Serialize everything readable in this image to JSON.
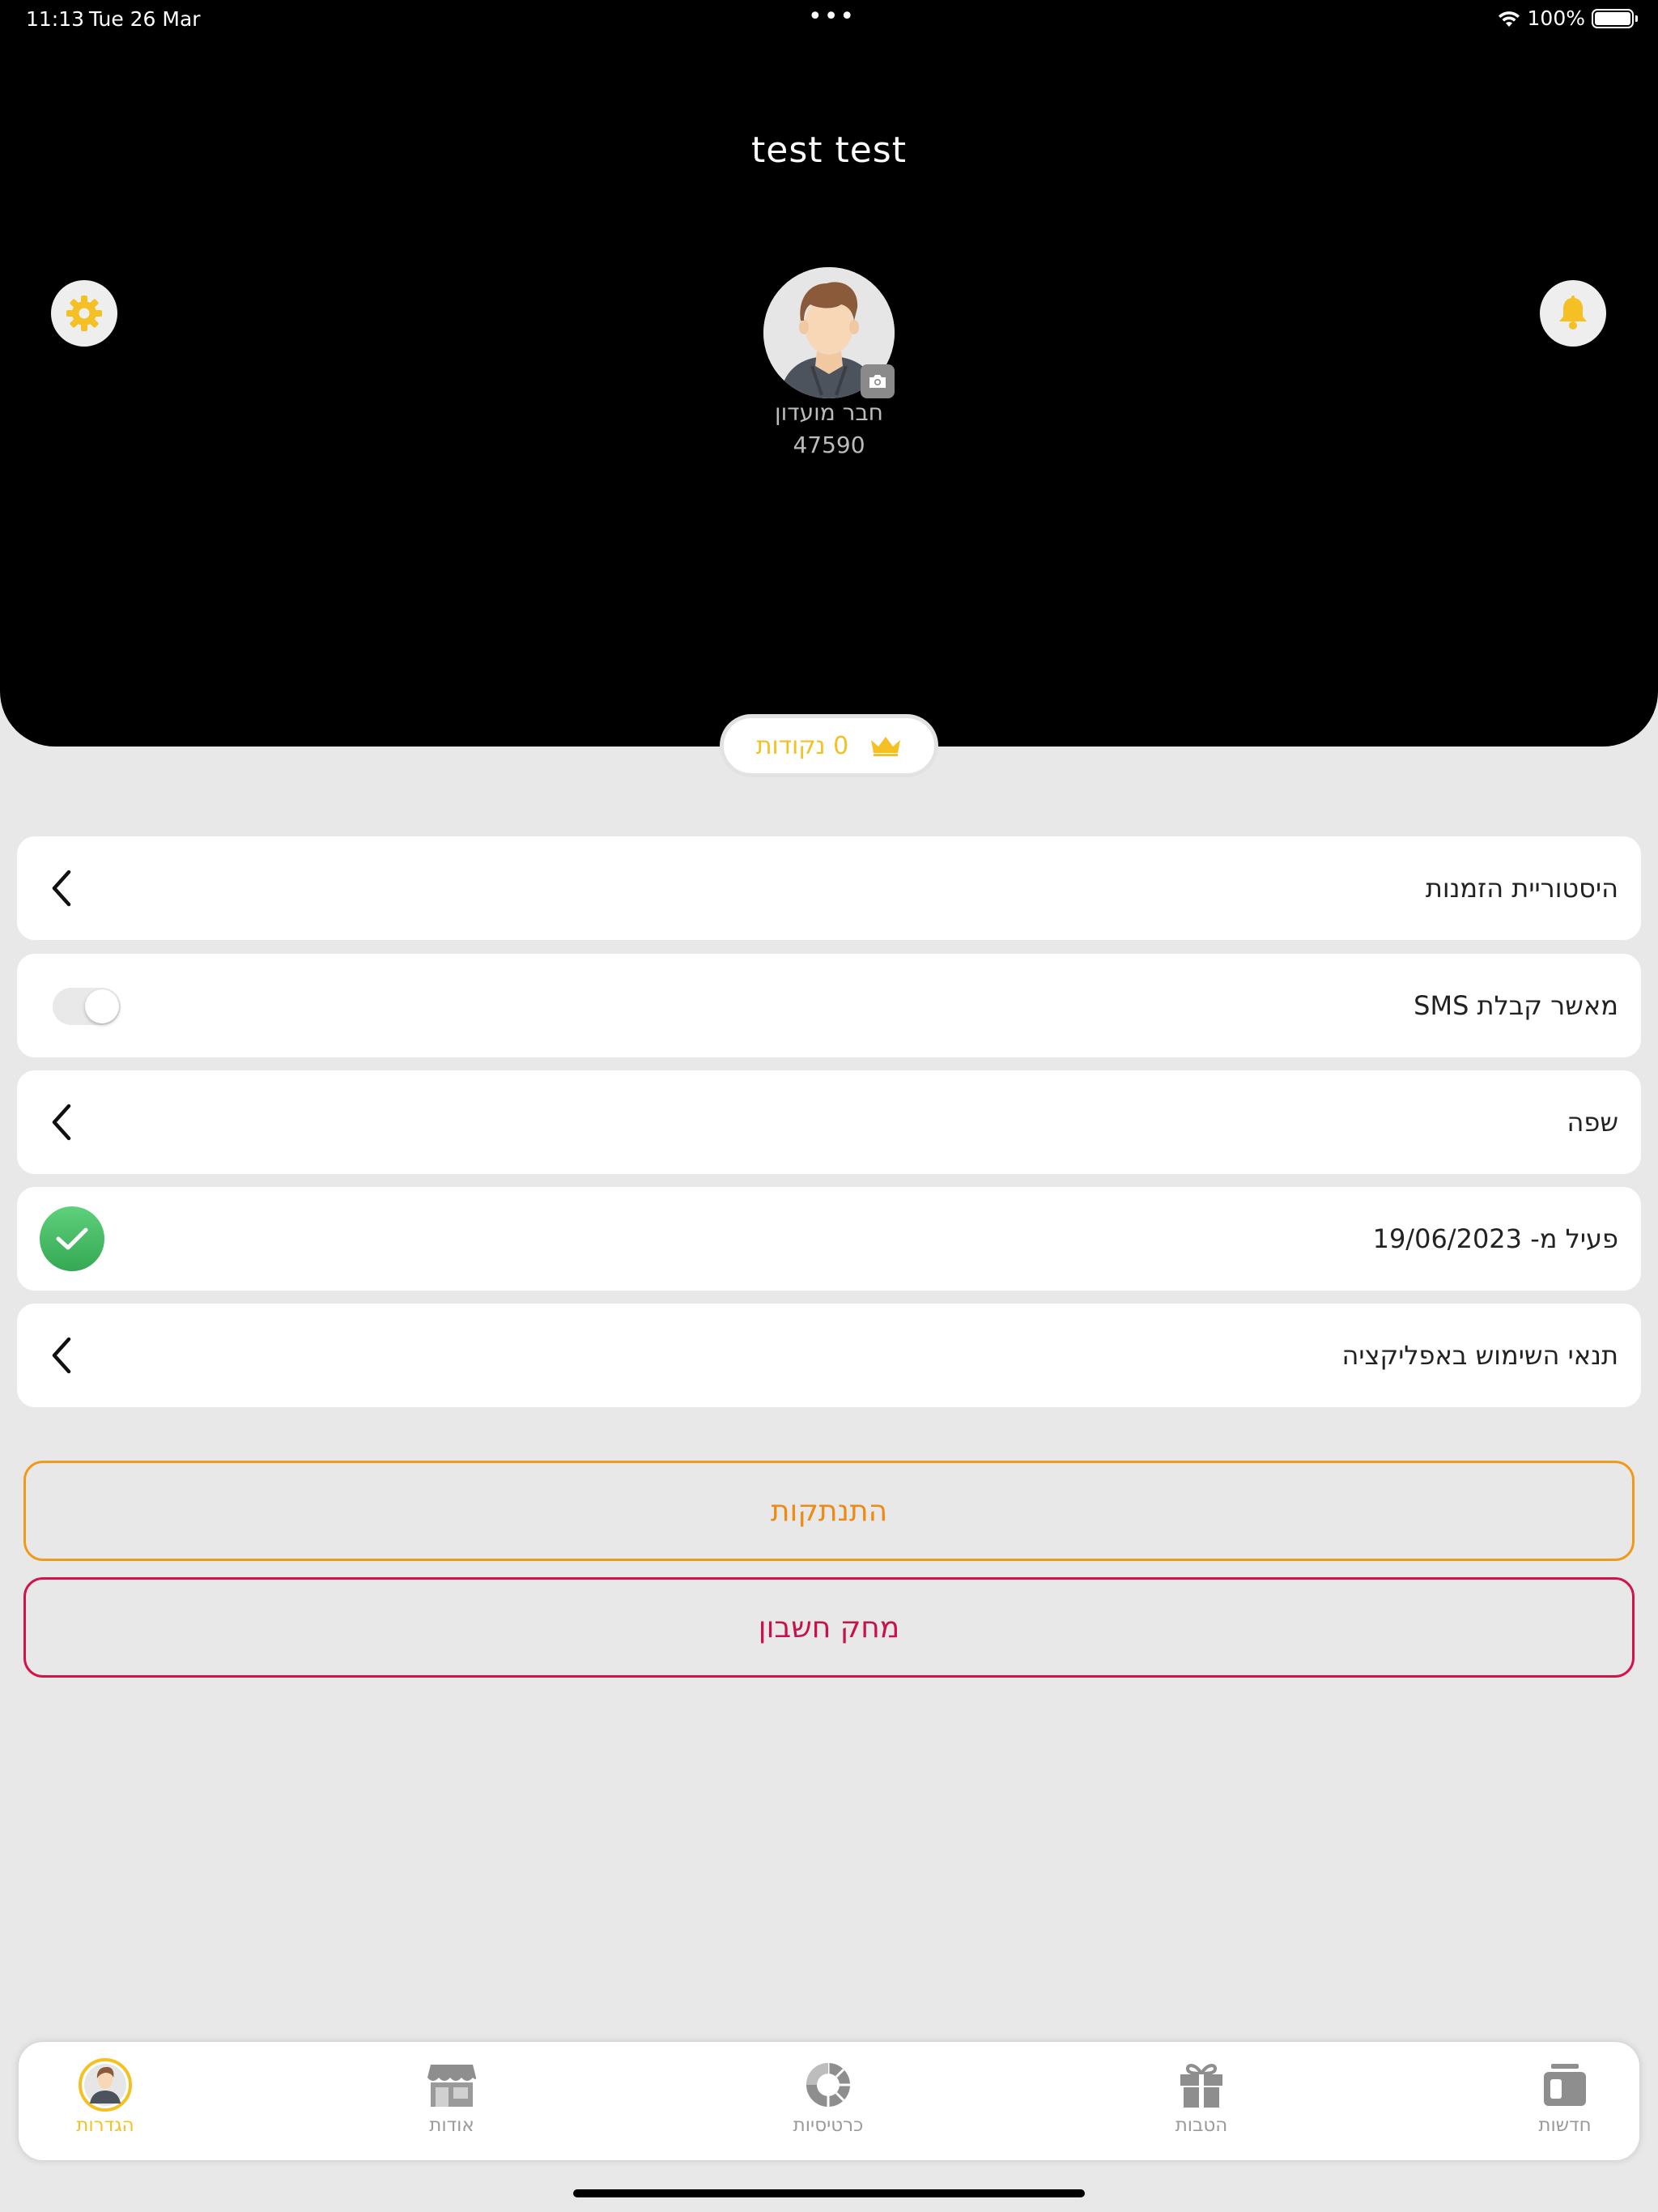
{
  "status_bar": {
    "time": "11:13",
    "date": "Tue 26 Mar",
    "dots": "•••",
    "battery": "100%"
  },
  "header": {
    "title": "test test",
    "member_label": "חבר מועדון",
    "member_number": "47590"
  },
  "points": {
    "text": "0 נקודות"
  },
  "rows": [
    {
      "label": "היסטוריית הזמנות"
    },
    {
      "label": "מאשר קבלת SMS",
      "toggle_on": false
    },
    {
      "label": "שפה"
    },
    {
      "label": "פעיל מ- 19/06/2023",
      "verified": true
    },
    {
      "label": "תנאי השימוש באפליקציה"
    }
  ],
  "buttons": {
    "logout": "התנתקות",
    "delete": "מחק חשבון"
  },
  "tabs": [
    {
      "label": "הגדרות",
      "icon": "profile-icon",
      "active": true
    },
    {
      "label": "אודות",
      "icon": "store-icon"
    },
    {
      "label": "כרטיסיות",
      "icon": "punch-card-icon"
    },
    {
      "label": "הטבות",
      "icon": "gift-icon"
    },
    {
      "label": "חדשות",
      "icon": "news-icon"
    }
  ],
  "colors": {
    "accent": "#f5c023",
    "logout": "#ef8a12",
    "delete": "#c8114a",
    "success": "#34a853"
  }
}
